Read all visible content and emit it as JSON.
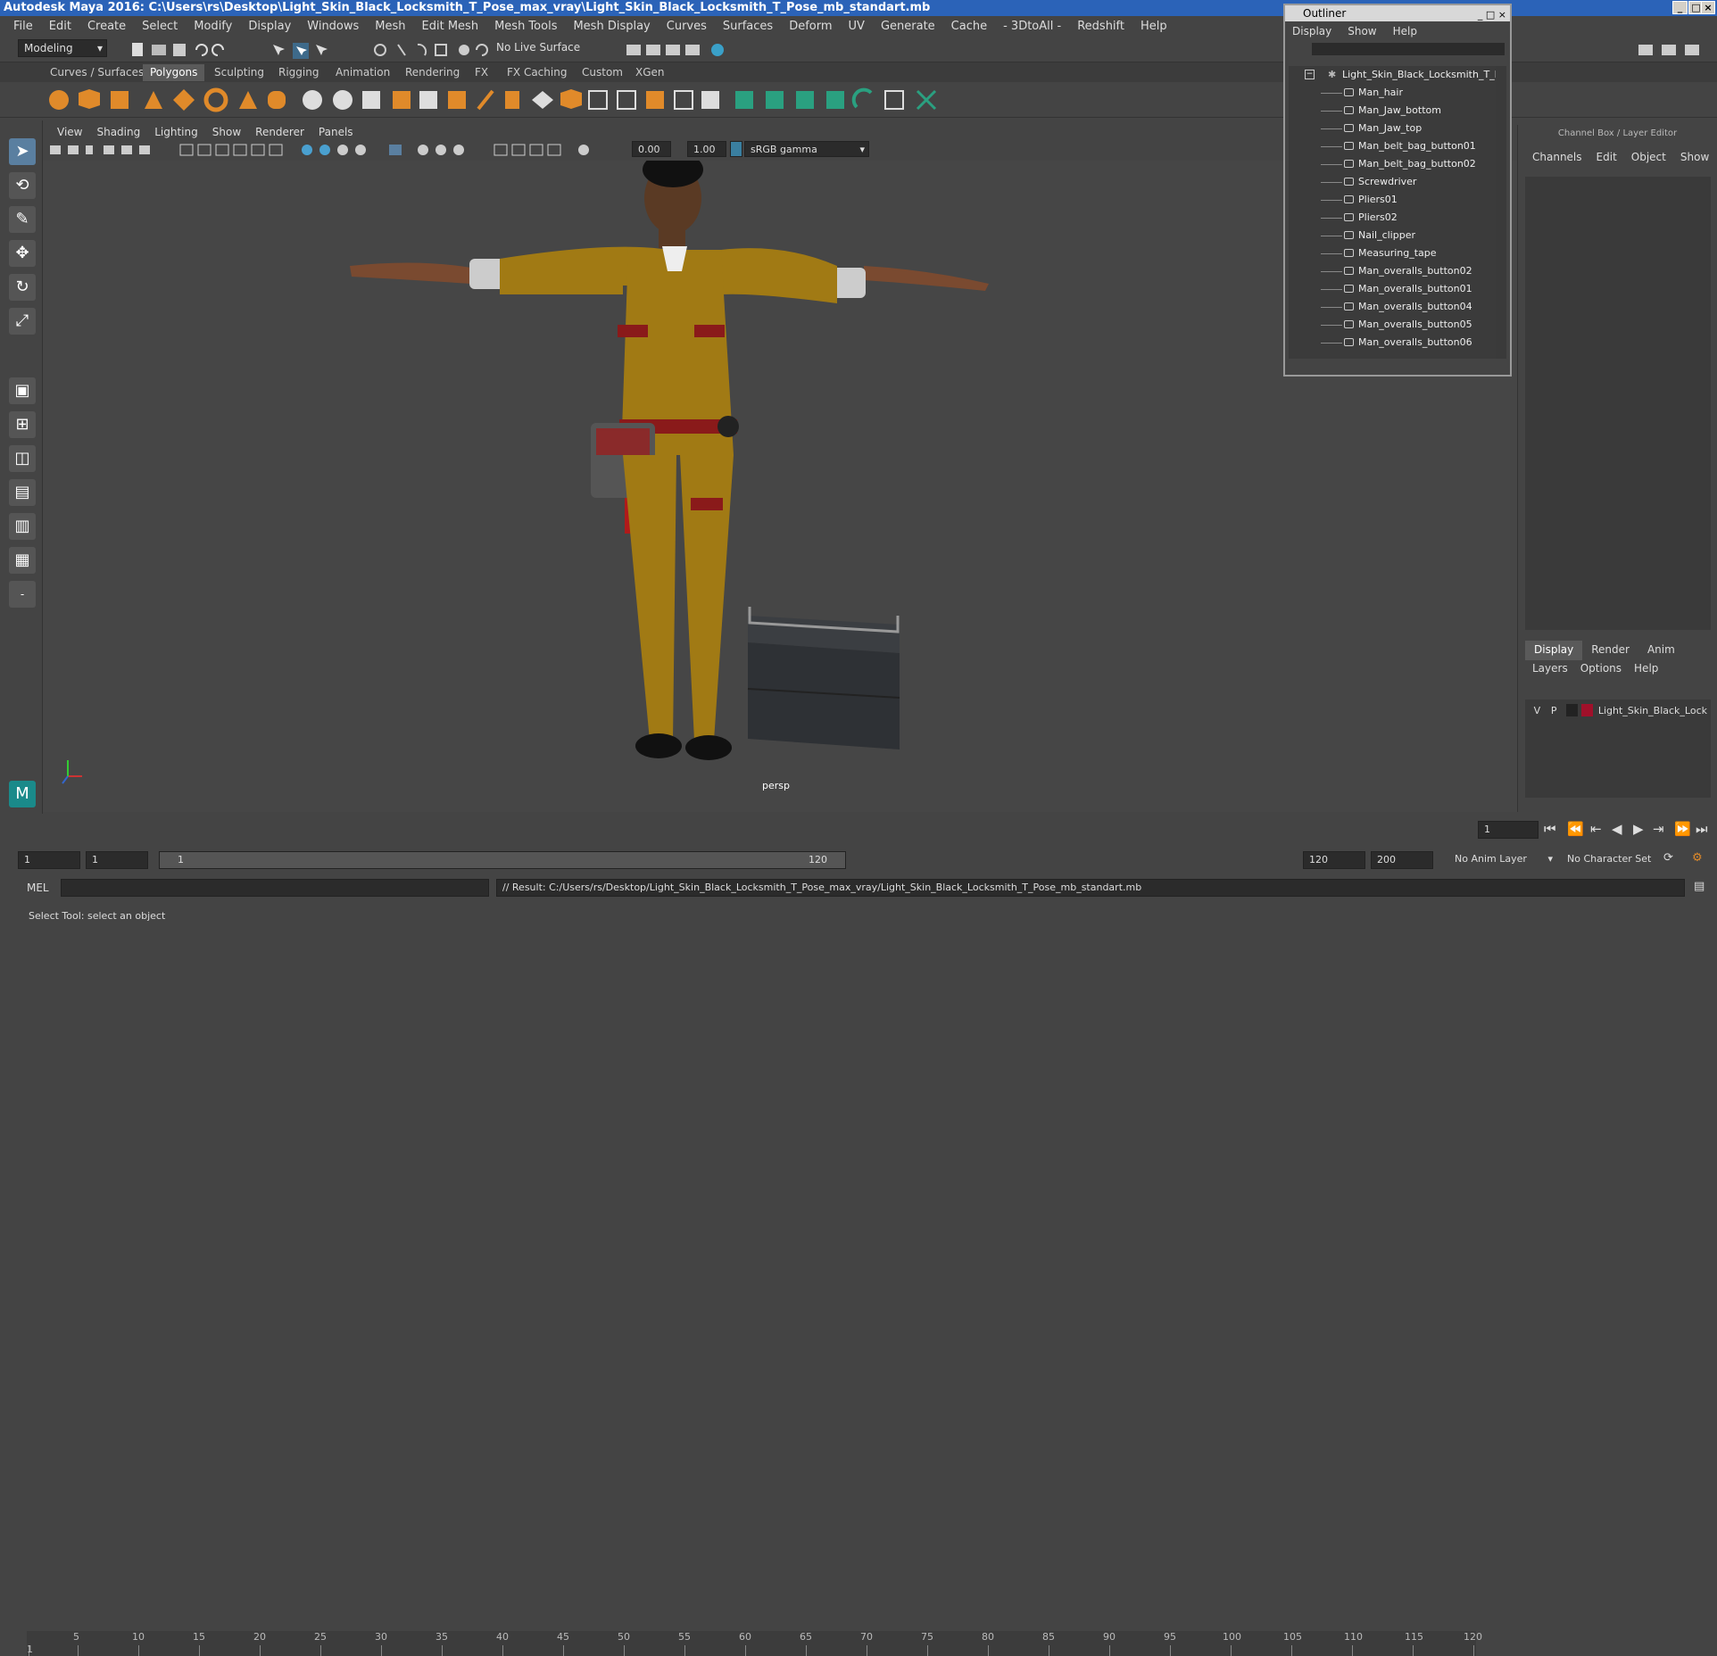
{
  "window": {
    "title": "Autodesk Maya 2016: C:\\Users\\rs\\Desktop\\Light_Skin_Black_Locksmith_T_Pose_max_vray\\Light_Skin_Black_Locksmith_T_Pose_mb_standart.mb"
  },
  "menubar": [
    "File",
    "Edit",
    "Create",
    "Select",
    "Modify",
    "Display",
    "Windows",
    "Mesh",
    "Edit Mesh",
    "Mesh Tools",
    "Mesh Display",
    "Curves",
    "Surfaces",
    "Deform",
    "UV",
    "Generate",
    "Cache",
    "- 3DtoAll -",
    "Redshift",
    "Help"
  ],
  "status_line": {
    "mode": "Modeling",
    "live_surface": "No Live Surface"
  },
  "shelf_tabs": [
    "Curves / Surfaces",
    "Polygons",
    "Sculpting",
    "Rigging",
    "Animation",
    "Rendering",
    "FX",
    "FX Caching",
    "Custom",
    "XGen"
  ],
  "active_shelf_tab": "Polygons",
  "viewport": {
    "menu": [
      "View",
      "Shading",
      "Lighting",
      "Show",
      "Renderer",
      "Panels"
    ],
    "exposure": "0.00",
    "gamma": "1.00",
    "color_space": "sRGB gamma",
    "camera_label": "persp"
  },
  "outliner": {
    "title": "Outliner",
    "menu": [
      "Display",
      "Show",
      "Help"
    ],
    "root": "Light_Skin_Black_Locksmith_T_Po",
    "items": [
      "Man_hair",
      "Man_Jaw_bottom",
      "Man_Jaw_top",
      "Man_belt_bag_button01",
      "Man_belt_bag_button02",
      "Screwdriver",
      "Pliers01",
      "Pliers02",
      "Nail_clipper",
      "Measuring_tape",
      "Man_overalls_button02",
      "Man_overalls_button01",
      "Man_overalls_button04",
      "Man_overalls_button05",
      "Man_overalls_button06"
    ]
  },
  "channel_box": {
    "header": "Channel Box / Layer Editor",
    "menu": [
      "Channels",
      "Edit",
      "Object",
      "Show"
    ],
    "tabs": [
      "Display",
      "Render",
      "Anim"
    ],
    "active_tab": "Display",
    "layer_menu": [
      "Layers",
      "Options",
      "Help"
    ],
    "layer": {
      "v": "V",
      "p": "P",
      "name": "Light_Skin_Black_Lock",
      "color": "#a0102a"
    }
  },
  "timeline": {
    "ticks": [
      "1",
      "5",
      "10",
      "15",
      "20",
      "25",
      "30",
      "35",
      "40",
      "45",
      "50",
      "55",
      "60",
      "65",
      "70",
      "75",
      "80",
      "85",
      "90",
      "95",
      "100",
      "105",
      "110",
      "115",
      "120"
    ],
    "current_frame": "1"
  },
  "range": {
    "start": "1",
    "playback_start": "1",
    "slider_start": "1",
    "slider_end": "120",
    "playback_end": "120",
    "end": "200",
    "anim_layer": "No Anim Layer",
    "character_set": "No Character Set"
  },
  "command_line": {
    "lang": "MEL",
    "result": "// Result: C:/Users/rs/Desktop/Light_Skin_Black_Locksmith_T_Pose_max_vray/Light_Skin_Black_Locksmith_T_Pose_mb_standart.mb"
  },
  "help_line": "Select Tool: select an object"
}
